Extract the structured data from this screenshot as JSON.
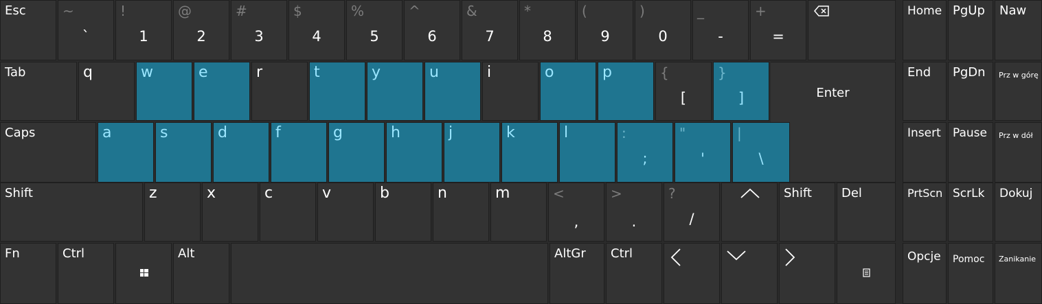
{
  "colors": {
    "background": "#2b2b2b",
    "key": "#333333",
    "highlight": "#1f7590",
    "highlight_text": "#9be6ff"
  },
  "row1": {
    "esc": "Esc",
    "digits": [
      {
        "shift": "~",
        "main": "`"
      },
      {
        "shift": "!",
        "main": "1"
      },
      {
        "shift": "@",
        "main": "2"
      },
      {
        "shift": "#",
        "main": "3"
      },
      {
        "shift": "$",
        "main": "4"
      },
      {
        "shift": "%",
        "main": "5"
      },
      {
        "shift": "^",
        "main": "6"
      },
      {
        "shift": "&",
        "main": "7"
      },
      {
        "shift": "*",
        "main": "8"
      },
      {
        "shift": "(",
        "main": "9"
      },
      {
        "shift": ")",
        "main": "0"
      },
      {
        "shift": "_",
        "main": "-"
      },
      {
        "shift": "+",
        "main": "="
      }
    ],
    "backspace_icon": "backspace-icon"
  },
  "row2": {
    "tab": "Tab",
    "letters": [
      "q",
      "w",
      "e",
      "r",
      "t",
      "y",
      "u",
      "i",
      "o",
      "p"
    ],
    "bracket_left": {
      "shift": "{",
      "main": "["
    },
    "bracket_right": {
      "shift": "}",
      "main": "]"
    },
    "enter": "Enter"
  },
  "row3": {
    "caps": "Caps",
    "letters": [
      "a",
      "s",
      "d",
      "f",
      "g",
      "h",
      "j",
      "k",
      "l"
    ],
    "semicolon": {
      "shift": ":",
      "main": ";"
    },
    "quote": {
      "shift": "\"",
      "main": "'"
    },
    "backslash": {
      "shift": "|",
      "main": "\\"
    }
  },
  "row4": {
    "shift": "Shift",
    "letters": [
      "z",
      "x",
      "c",
      "v",
      "b",
      "n",
      "m"
    ],
    "comma": {
      "shift": "<",
      "main": ","
    },
    "period": {
      "shift": ">",
      "main": "."
    },
    "slash": {
      "shift": "?",
      "main": "/"
    },
    "up_icon": "chevron-up-icon",
    "shift_right": "Shift",
    "del": "Del"
  },
  "row5": {
    "fn": "Fn",
    "ctrl": "Ctrl",
    "win_icon": "windows-icon",
    "alt": "Alt",
    "altgr": "AltGr",
    "ctrl_right": "Ctrl",
    "left_icon": "chevron-left-icon",
    "down_icon": "chevron-down-icon",
    "right_icon": "chevron-right-icon",
    "menu_icon": "context-menu-icon"
  },
  "nav": {
    "home": "Home",
    "pgup": "PgUp",
    "naw": "Naw",
    "end": "End",
    "pgdn": "PgDn",
    "scroll_up": "Prz w górę",
    "insert": "Insert",
    "pause": "Pause",
    "scroll_down": "Prz w dół",
    "prtscn": "PrtScn",
    "scrlk": "ScrLk",
    "dock": "Dokuj",
    "options": "Opcje",
    "help": "Pomoc",
    "fade": "Zanikanie"
  }
}
